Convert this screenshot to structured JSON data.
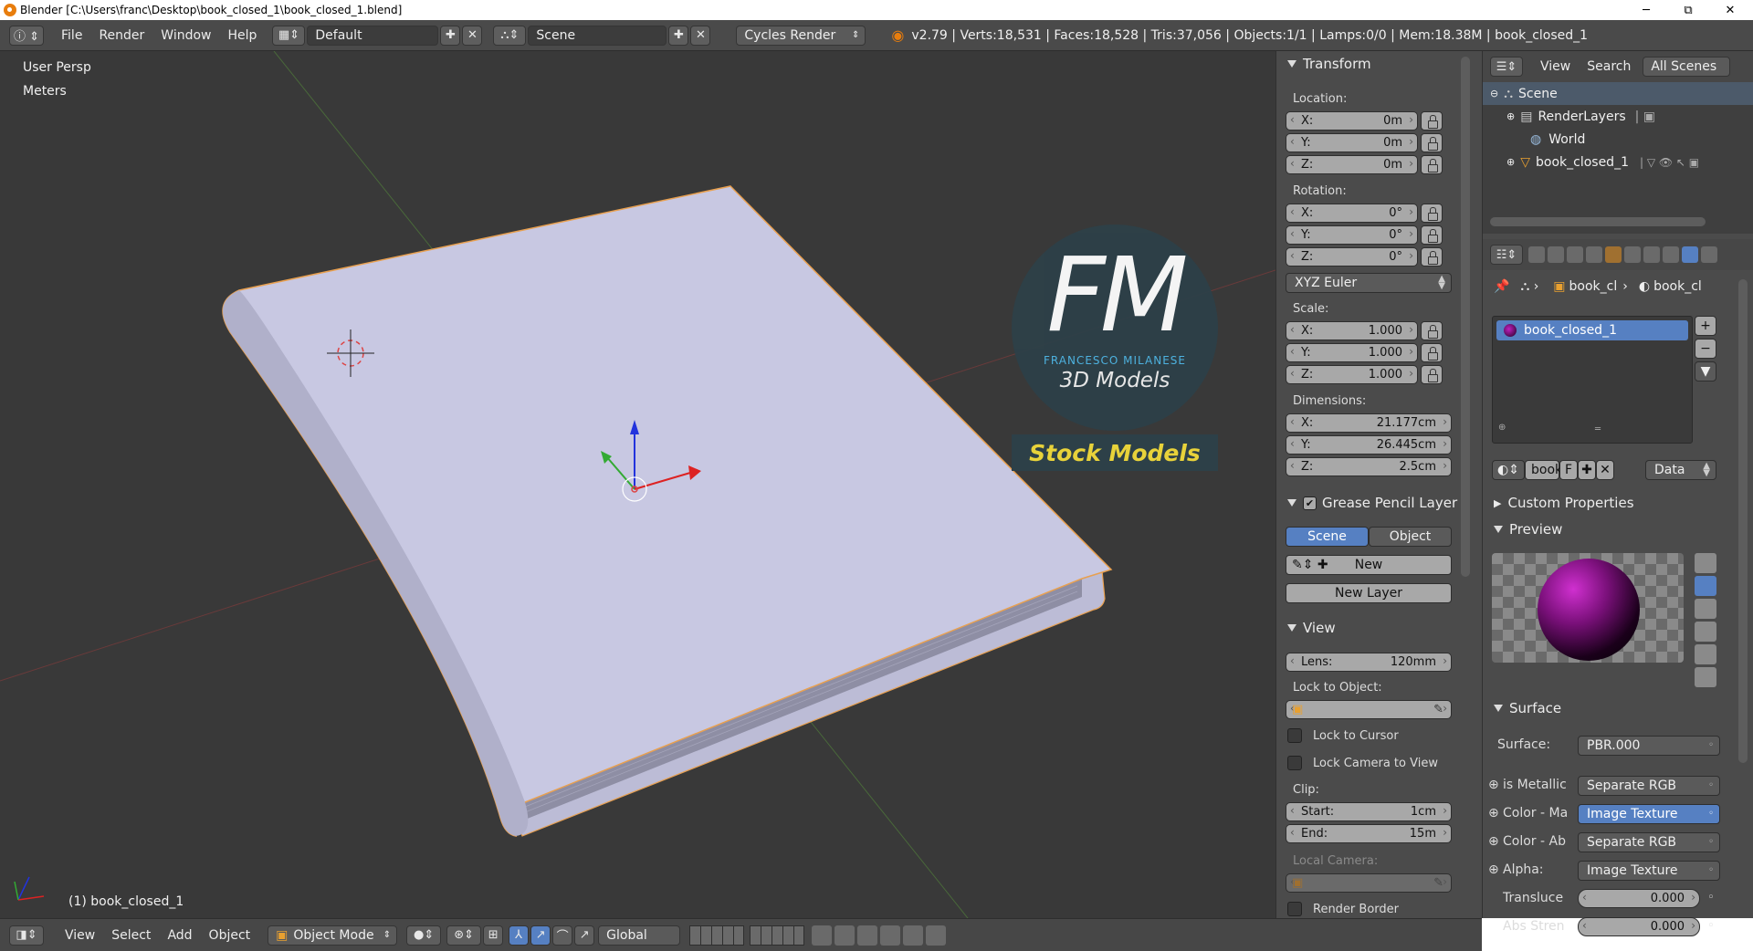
{
  "window": {
    "title": "Blender [C:\\Users\\franc\\Desktop\\book_closed_1\\book_closed_1.blend]",
    "minimize": "─",
    "maximize": "⧉",
    "close": "✕"
  },
  "topbar": {
    "menus": [
      "File",
      "Render",
      "Window",
      "Help"
    ],
    "layout": "Default",
    "scene": "Scene",
    "engine": "Cycles Render",
    "stats": "v2.79 | Verts:18,531 | Faces:18,528 | Tris:37,056 | Objects:1/1 | Lamps:0/0 | Mem:18.38M | book_closed_1"
  },
  "viewport": {
    "view_name": "User Persp",
    "units": "Meters",
    "active_object": "(1) book_closed_1",
    "watermark": {
      "initials": "FM",
      "author": "FRANCESCO MILANESE",
      "sub": "3D Models",
      "banner": "Stock Models"
    }
  },
  "transform": {
    "title": "Transform",
    "location_label": "Location:",
    "location": [
      {
        "k": "X:",
        "v": "0m"
      },
      {
        "k": "Y:",
        "v": "0m"
      },
      {
        "k": "Z:",
        "v": "0m"
      }
    ],
    "rotation_label": "Rotation:",
    "rotation": [
      {
        "k": "X:",
        "v": "0°"
      },
      {
        "k": "Y:",
        "v": "0°"
      },
      {
        "k": "Z:",
        "v": "0°"
      }
    ],
    "rotation_mode": "XYZ Euler",
    "scale_label": "Scale:",
    "scale": [
      {
        "k": "X:",
        "v": "1.000"
      },
      {
        "k": "Y:",
        "v": "1.000"
      },
      {
        "k": "Z:",
        "v": "1.000"
      }
    ],
    "dimensions_label": "Dimensions:",
    "dimensions": [
      {
        "k": "X:",
        "v": "21.177cm"
      },
      {
        "k": "Y:",
        "v": "26.445cm"
      },
      {
        "k": "Z:",
        "v": "2.5cm"
      }
    ]
  },
  "grease": {
    "title": "Grease Pencil Layer",
    "scene": "Scene",
    "object": "Object",
    "new": "New",
    "new_layer": "New Layer"
  },
  "view": {
    "title": "View",
    "lens_k": "Lens:",
    "lens_v": "120mm",
    "lock_obj": "Lock to Object:",
    "lock_cursor": "Lock to Cursor",
    "lock_camera": "Lock Camera to View",
    "clip": "Clip:",
    "start_k": "Start:",
    "start_v": "1cm",
    "end_k": "End:",
    "end_v": "15m",
    "local_camera": "Local Camera:",
    "render_border": "Render Border"
  },
  "outliner": {
    "view": "View",
    "search": "Search",
    "all_scenes": "All Scenes",
    "items": [
      "Scene",
      "RenderLayers",
      "World",
      "book_closed_1"
    ]
  },
  "props": {
    "crumb1": "book_cl",
    "crumb2": "book_cl",
    "material_slot": "book_closed_1",
    "mat_name": "book",
    "mat_f": "F",
    "data": "Data",
    "custom_props": "Custom Properties",
    "preview": "Preview",
    "surface_title": "Surface",
    "surface_k": "Surface:",
    "surface_v": "PBR.000",
    "rows": [
      {
        "k": "is Metallic",
        "v": "Separate RGB"
      },
      {
        "k": "Color - Ma",
        "v": "Image Texture"
      },
      {
        "k": "Color - Ab",
        "v": "Separate RGB"
      },
      {
        "k": "Alpha:",
        "v": "Image Texture"
      }
    ],
    "transl_k": "Transluce",
    "transl_v": "0.000",
    "abs_k": "Abs Stren",
    "abs_v": "0.000"
  },
  "bottombar": {
    "menus": [
      "View",
      "Select",
      "Add",
      "Object"
    ],
    "mode": "Object Mode",
    "orientation": "Global"
  },
  "colors": {
    "accent": "#5680c2",
    "select_outline": "#f0a040",
    "book": "#c8c8e0"
  }
}
